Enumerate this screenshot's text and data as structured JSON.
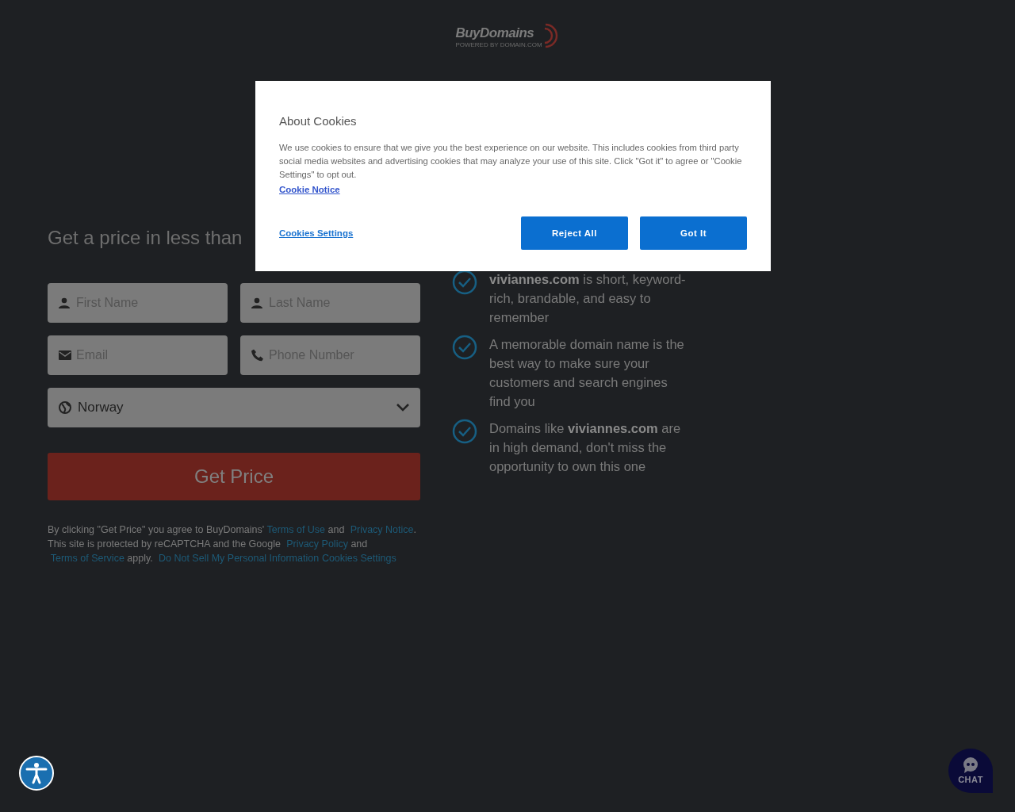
{
  "logo": {
    "name": "BuyDomains",
    "tagline": "POWERED BY DOMAIN.COM"
  },
  "form": {
    "heading": "Get a price in less than",
    "fields": [
      {
        "kind": "person",
        "placeholder": "First Name"
      },
      {
        "kind": "person",
        "placeholder": "Last Name"
      },
      {
        "kind": "email",
        "placeholder": "Email"
      },
      {
        "kind": "phone",
        "placeholder": "Phone Number"
      }
    ],
    "country": {
      "value": "Norway"
    },
    "submit": "Get Price",
    "legal": [
      {
        "kind": "text",
        "text": "By clicking \"Get Price\" you agree to BuyDomains' "
      },
      {
        "kind": "link",
        "text": "Terms of Use"
      },
      {
        "kind": "text",
        "text": " and "
      },
      {
        "kind": "link",
        "text": "Privacy Notice"
      },
      {
        "kind": "text",
        "text": ". This site is protected by reCAPTCHA and the Google "
      },
      {
        "kind": "link",
        "text": "Privacy Policy"
      },
      {
        "kind": "text",
        "text": " and "
      },
      {
        "kind": "link",
        "text": "Terms of Service"
      },
      {
        "kind": "text",
        "text": " apply. "
      },
      {
        "kind": "link",
        "text": "Do Not Sell My Personal Information"
      },
      {
        "kind": "link",
        "text": "Cookies Settings"
      }
    ]
  },
  "benefits": [
    "**viviannes.com**  is short, keyword-rich, brandable, and easy to remember",
    "A memorable domain name is the best way to make sure your customers and search engines find you",
    "Domains like **viviannes.com**  are in high demand, don't miss the opportunity to own this one"
  ],
  "cookie_dialog": {
    "title": "About Cookies",
    "body": "We use cookies to ensure that we give you the best experience on our website. This includes cookies from third party social media websites and advertising cookies that may analyze your use of this site. Click \"Got it\" to agree or \"Cookie Settings\" to opt out.",
    "notice_link": "Cookie Notice",
    "settings_link": "Cookies Settings",
    "buttons": [
      "Reject All",
      "Got It"
    ]
  },
  "chat": {
    "label": "CHAT"
  }
}
